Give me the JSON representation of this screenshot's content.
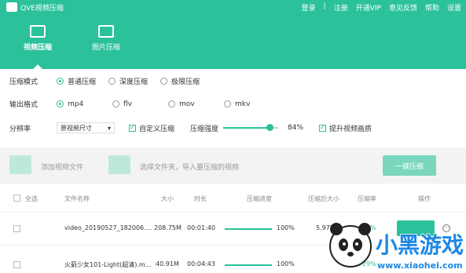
{
  "app": {
    "title": "QVE视频压缩"
  },
  "top_menu": [
    "登录",
    "注册",
    "开通VIP",
    "意见反馈",
    "帮助",
    "设置"
  ],
  "tabs": [
    {
      "label": "视频压缩",
      "active": true,
      "icon": "clapperboard-icon"
    },
    {
      "label": "图片压缩",
      "active": false,
      "icon": "image-icon"
    }
  ],
  "settings": {
    "mode_label": "压缩模式",
    "modes": [
      "普通压缩",
      "深度压缩",
      "极限压缩"
    ],
    "mode_selected": "普通压缩",
    "format_label": "输出格式",
    "formats": [
      "mp4",
      "flv",
      "mov",
      "mkv"
    ],
    "format_selected": "mp4",
    "resolution_label": "分辨率",
    "resolution_value": "原视频尺寸",
    "custom_label": "自定义压缩",
    "strength_label": "压缩强度",
    "strength_value": "84%",
    "strength_fraction": 0.84,
    "enhance_label": "提升视频画质"
  },
  "dropzone": {
    "add_video": "添加视频文件",
    "select_folder": "选择文件夹，导入要压缩的视频",
    "compress_all": "一键压缩"
  },
  "table": {
    "headers": [
      "全选",
      "文件名称",
      "大小",
      "时长",
      "压缩进度",
      "压缩后大小",
      "压缩率",
      "操作"
    ],
    "rows": [
      {
        "name": "video_20190527_182006....",
        "size": "208.75M",
        "duration": "00:01:40",
        "progress": "100%",
        "after": "5.97M",
        "ratio": "14%"
      },
      {
        "name": "火箭少女101-Light(超清).m...",
        "size": "40.91M",
        "duration": "00:04:43",
        "progress": "100%",
        "after": "",
        "ratio": "29%"
      }
    ]
  },
  "watermark": {
    "text": "小黑游戏",
    "url": "www.xiaohei.com"
  },
  "colors": {
    "accent": "#2bc19a",
    "accent_light": "#7ad7bd"
  }
}
